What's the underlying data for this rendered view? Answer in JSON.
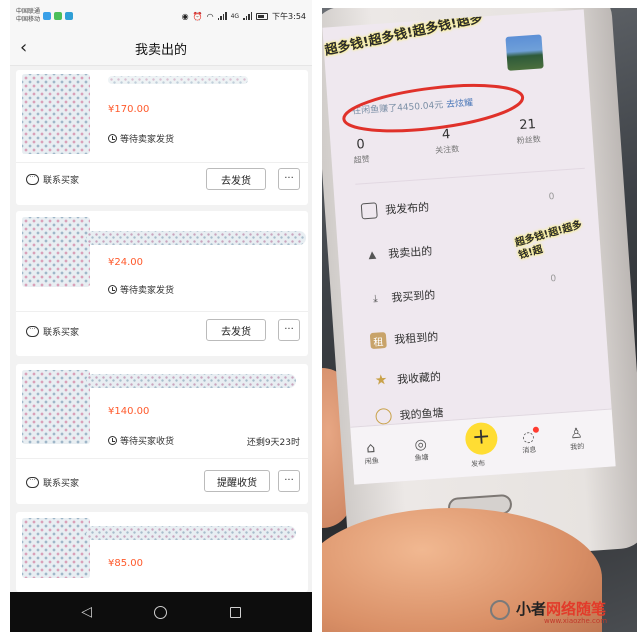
{
  "status_bar": {
    "carrier_1": "中国联通",
    "carrier_2": "中国移动",
    "network": "4G",
    "time": "下午3:54"
  },
  "header": {
    "title": "我卖出的"
  },
  "orders": [
    {
      "price": "¥170.00",
      "status": "等待卖家发货",
      "contact_label": "联系买家",
      "action_label": "去发货",
      "more_label": "···"
    },
    {
      "price": "¥24.00",
      "status": "等待卖家发货",
      "contact_label": "联系买家",
      "action_label": "去发货",
      "more_label": "···"
    },
    {
      "price": "¥140.00",
      "status": "等待买家收货",
      "remaining": "还剩9天23时",
      "contact_label": "联系买家",
      "action_label": "提醒收货",
      "more_label": "···"
    },
    {
      "price": "¥85.00"
    }
  ],
  "photo": {
    "earned_text": "在闲鱼赚了4450.04元",
    "earned_link": "去炫耀",
    "stats": [
      {
        "value": "0",
        "label": "超赞"
      },
      {
        "value": "4",
        "label": "关注数"
      },
      {
        "value": "21",
        "label": "粉丝数"
      }
    ],
    "menu": [
      {
        "label": "我发布的",
        "count": "0"
      },
      {
        "label": "我卖出的",
        "count": ""
      },
      {
        "label": "我买到的",
        "count": "0"
      },
      {
        "label": "我租到的",
        "count": ""
      },
      {
        "label": "我收藏的",
        "count": ""
      },
      {
        "label": "我的鱼塘",
        "count": ""
      }
    ],
    "tabs": [
      {
        "label": "闲鱼"
      },
      {
        "label": "鱼塘"
      },
      {
        "label": "发布"
      },
      {
        "label": "消息"
      },
      {
        "label": "我的"
      }
    ],
    "scribble_top": "超多钱!超多钱!超多钱!超多",
    "scribble_side": "超多钱!超!超多钱!超"
  },
  "watermark": {
    "name_prefix": "小者",
    "name_red": "网络随笔",
    "url": "www.xiaozhe.com"
  },
  "colors": {
    "price": "#ff5a2c",
    "publish_button": "#ffdd33",
    "link": "#4a77b8"
  }
}
